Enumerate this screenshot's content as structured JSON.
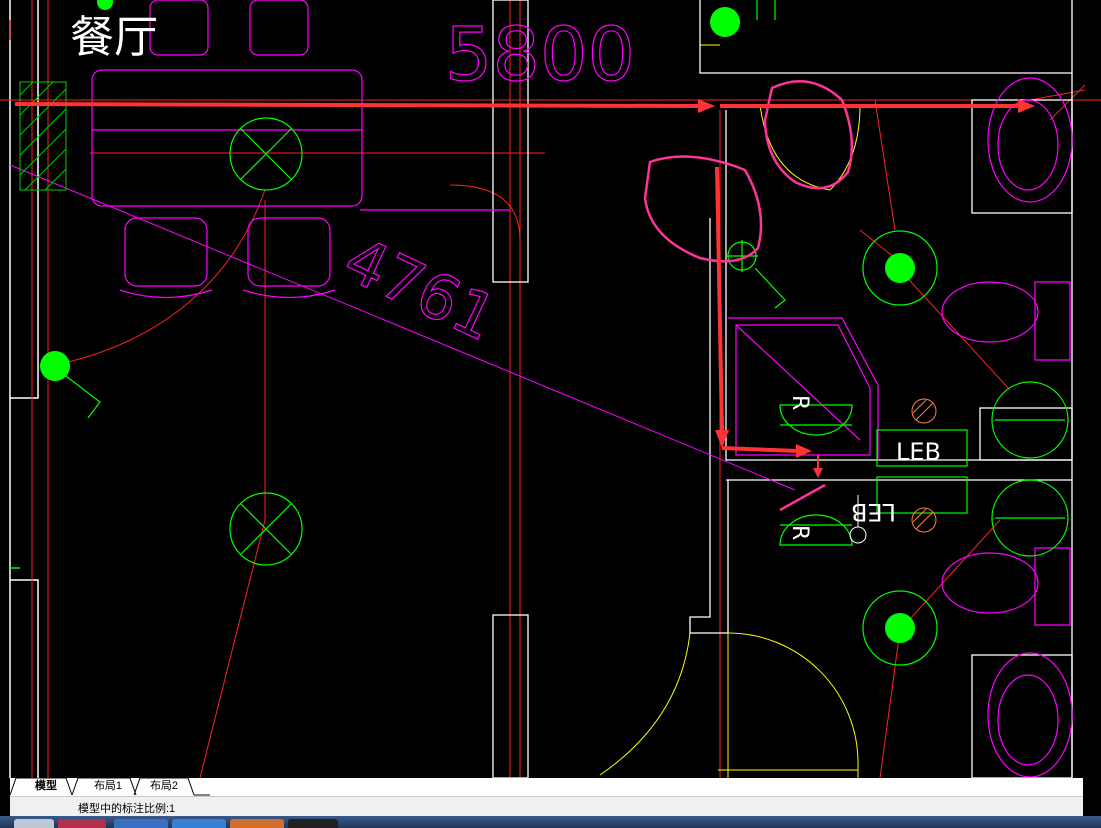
{
  "drawing": {
    "room_label": "餐厅",
    "dim_top": "5800",
    "dim_diag": "4761",
    "leb_1": "LEB",
    "leb_2": "LEB",
    "fixture_r_1": "R",
    "fixture_r_2": "R"
  },
  "tabs": [
    {
      "label": "模型",
      "active": true
    },
    {
      "label": "布局1",
      "active": false
    },
    {
      "label": "布局2",
      "active": false
    }
  ],
  "status": {
    "text": "模型中的标注比例:1"
  },
  "colors": {
    "background": "#000000",
    "wall_red": "#ff2020",
    "furniture_magenta": "#ff00ff",
    "light_green": "#00ff00",
    "door_yellow": "#ffff00",
    "wall_white": "#ffffff",
    "annotation_red": "#ff3333",
    "annotation_pink": "#ff3399"
  }
}
